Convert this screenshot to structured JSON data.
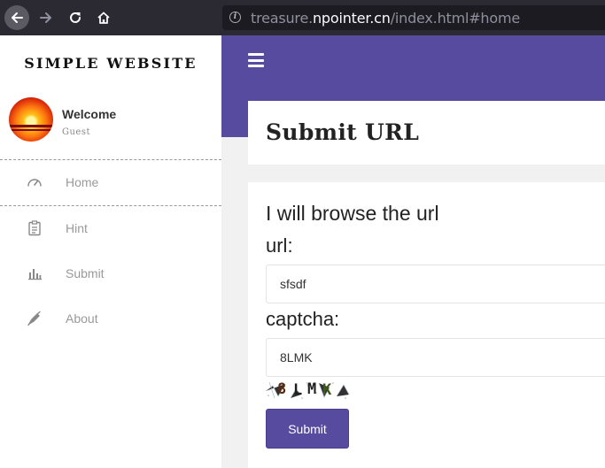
{
  "browser": {
    "url_scheme_host_prefix": "treasure.",
    "url_host": "npointer.cn",
    "url_path": "/index.html#home"
  },
  "sidebar": {
    "brand": "SIMPLE WEBSITE",
    "profile": {
      "welcome": "Welcome",
      "role": "Guest"
    },
    "items": [
      {
        "label": "Home",
        "icon": "speedometer-icon"
      },
      {
        "label": "Hint",
        "icon": "clipboard-icon"
      },
      {
        "label": "Submit",
        "icon": "bar-chart-icon"
      },
      {
        "label": "About",
        "icon": "pen-icon"
      }
    ]
  },
  "main": {
    "title": "Submit URL",
    "form": {
      "heading": "I will browse the url",
      "url_label": "url:",
      "url_value": "sfsdf",
      "captcha_label": "captcha:",
      "captcha_value": "8LMK",
      "captcha_image_text": "8LMK",
      "submit_label": "Submit"
    }
  },
  "colors": {
    "accent": "#574ba0",
    "chrome": "#2b2a33",
    "sidebar": "#ffffff",
    "page_bg": "#f1f1f1"
  }
}
